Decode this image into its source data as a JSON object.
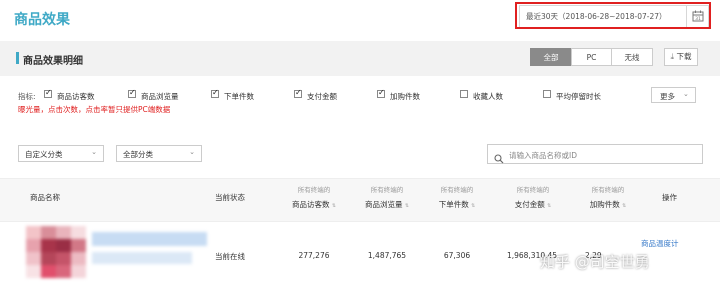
{
  "header": {
    "title": "商品效果",
    "date_range": "最近30天（2018-06-28~2018-07-27）"
  },
  "section": {
    "title": "商品效果明细",
    "tabs": [
      {
        "label": "全部",
        "active": true
      },
      {
        "label": "PC",
        "active": false
      },
      {
        "label": "无线",
        "active": false
      }
    ],
    "download_label": "下载"
  },
  "metrics": {
    "label": "指标:",
    "items": [
      {
        "label": "商品访客数",
        "checked": true
      },
      {
        "label": "商品浏览量",
        "checked": true
      },
      {
        "label": "下单件数",
        "checked": true
      },
      {
        "label": "支付金额",
        "checked": true
      },
      {
        "label": "加购件数",
        "checked": true
      },
      {
        "label": "收藏人数",
        "checked": false
      },
      {
        "label": "平均停留时长",
        "checked": false
      }
    ],
    "more_label": "更多",
    "hint": "曝光量，点击次数，点击率暂只提供PC端数据"
  },
  "filters": {
    "category_custom": "自定义分类",
    "category_all": "全部分类",
    "search_placeholder": "请输入商品名称或ID"
  },
  "table": {
    "columns": {
      "name": "商品名称",
      "status": "当前状态",
      "sub": "所有终端的",
      "visitors": "商品访客数",
      "views": "商品浏览量",
      "orders": "下单件数",
      "pay": "支付金额",
      "cart": "加购件数",
      "ops": "操作"
    },
    "rows": [
      {
        "status": "当前在线",
        "visitors": "277,276",
        "views": "1,487,765",
        "orders": "67,306",
        "pay": "1,968,310.45",
        "cart": "2,29",
        "op_link": "商品温度计"
      }
    ]
  },
  "watermark": "知乎 @司空世勇",
  "colors": {
    "accent": "#3fa9c6",
    "highlight": "#e02020",
    "link": "#3578c8"
  }
}
